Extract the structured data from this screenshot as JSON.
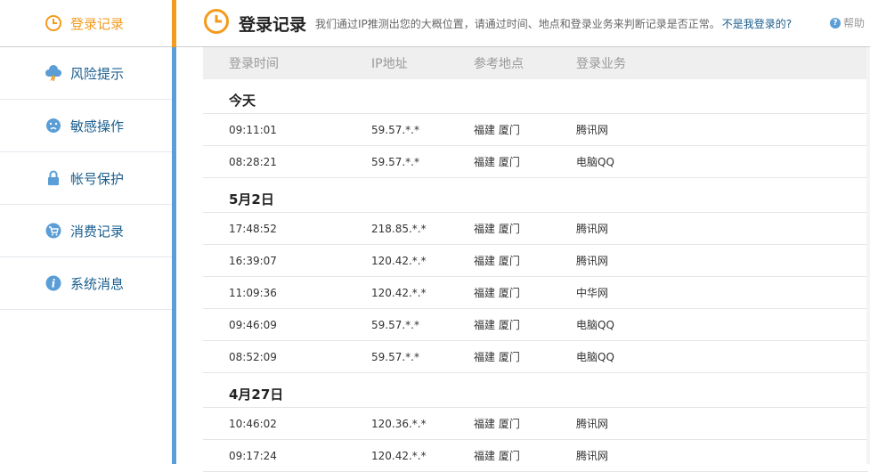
{
  "sidebar": {
    "items": [
      {
        "label": "登录记录",
        "icon": "clock-icon",
        "active": true
      },
      {
        "label": "风险提示",
        "icon": "cloud-alert-icon"
      },
      {
        "label": "敏感操作",
        "icon": "face-icon"
      },
      {
        "label": "帐号保护",
        "icon": "lock-icon"
      },
      {
        "label": "消费记录",
        "icon": "cart-icon"
      },
      {
        "label": "系统消息",
        "icon": "info-icon"
      }
    ]
  },
  "header": {
    "title": "登录记录",
    "description": "我们通过IP推测出您的大概位置，请通过时间、地点和登录业务来判断记录是否正常。",
    "not_me_link": "不是我登录的?",
    "help_label": "帮助"
  },
  "table": {
    "headers": [
      "登录时间",
      "IP地址",
      "参考地点",
      "登录业务"
    ],
    "groups": [
      {
        "date": "今天",
        "rows": [
          [
            "09:11:01",
            "59.57.*.*",
            "福建 厦门",
            "腾讯网"
          ],
          [
            "08:28:21",
            "59.57.*.*",
            "福建 厦门",
            "电脑QQ"
          ]
        ]
      },
      {
        "date": "5月2日",
        "rows": [
          [
            "17:48:52",
            "218.85.*.*",
            "福建 厦门",
            "腾讯网"
          ],
          [
            "16:39:07",
            "120.42.*.*",
            "福建 厦门",
            "腾讯网"
          ],
          [
            "11:09:36",
            "120.42.*.*",
            "福建 厦门",
            "中华网"
          ],
          [
            "09:46:09",
            "59.57.*.*",
            "福建 厦门",
            "电脑QQ"
          ],
          [
            "08:52:09",
            "59.57.*.*",
            "福建 厦门",
            "电脑QQ"
          ]
        ]
      },
      {
        "date": "4月27日",
        "rows": [
          [
            "10:46:02",
            "120.36.*.*",
            "福建 厦门",
            "腾讯网"
          ],
          [
            "09:17:24",
            "120.42.*.*",
            "福建 厦门",
            "腾讯网"
          ]
        ]
      }
    ]
  },
  "colors": {
    "accent_orange": "#f39b1d",
    "accent_blue": "#5b9dd6",
    "link": "#1a5e8e"
  }
}
